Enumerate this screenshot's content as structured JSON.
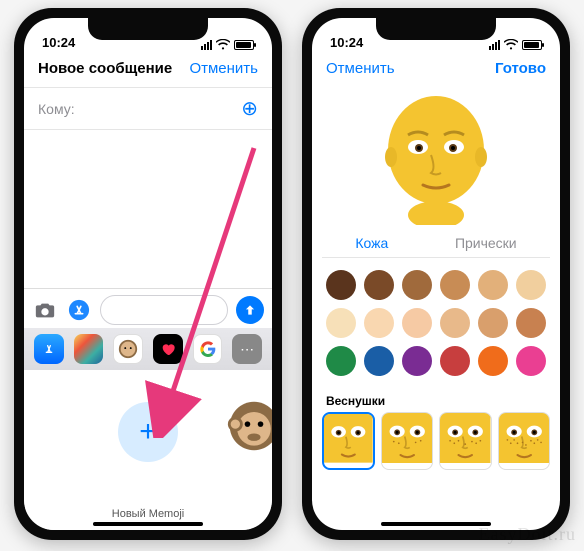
{
  "status": {
    "time": "10:24"
  },
  "left": {
    "title": "Новое сообщение",
    "cancel": "Отменить",
    "to_label": "Кому:",
    "app_icons": [
      "store-icon",
      "photos-icon",
      "memoji-icon",
      "hearts-icon",
      "google-icon",
      "more-icon"
    ],
    "new_memoji_label": "Новый Memoji"
  },
  "right": {
    "cancel": "Отменить",
    "done": "Готово",
    "tabs": {
      "skin": "Кожа",
      "hair": "Прически"
    },
    "skin_colors": [
      "#5a341d",
      "#7a4a28",
      "#a06a3c",
      "#c88c55",
      "#e2b07a",
      "#f1cf9e",
      "#f7e0b8",
      "#f9d7b0",
      "#f6caa4",
      "#e8b98a",
      "#d99f6c",
      "#c88150",
      "#1f8a47",
      "#1a5ea6",
      "#7a2c93",
      "#c73e3e",
      "#f06c1b",
      "#ea3f92"
    ],
    "freckles_label": "Веснушки",
    "freckles_count": 4
  },
  "watermark": "EasyDoit.ru"
}
